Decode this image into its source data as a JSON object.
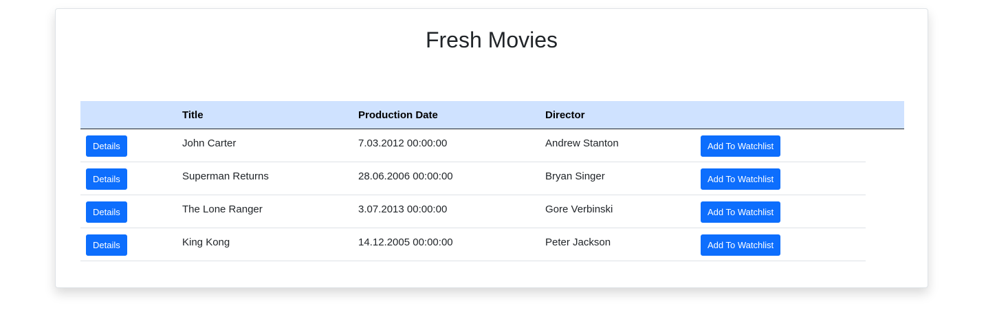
{
  "page": {
    "title": "Fresh Movies"
  },
  "table": {
    "headers": {
      "title": "Title",
      "production_date": "Production Date",
      "director": "Director"
    },
    "rows": [
      {
        "details_label": "Details",
        "title": "John Carter",
        "production_date": "7.03.2012 00:00:00",
        "director": "Andrew Stanton",
        "watchlist_label": "Add To Watchlist"
      },
      {
        "details_label": "Details",
        "title": "Superman Returns",
        "production_date": "28.06.2006 00:00:00",
        "director": "Bryan Singer",
        "watchlist_label": "Add To Watchlist"
      },
      {
        "details_label": "Details",
        "title": "The Lone Ranger",
        "production_date": "3.07.2013 00:00:00",
        "director": "Gore Verbinski",
        "watchlist_label": "Add To Watchlist"
      },
      {
        "details_label": "Details",
        "title": "King Kong",
        "production_date": "14.12.2005 00:00:00",
        "director": "Peter Jackson",
        "watchlist_label": "Add To Watchlist"
      }
    ]
  },
  "colors": {
    "accent": "#0d6efd",
    "header_bg": "#cfe2ff"
  }
}
